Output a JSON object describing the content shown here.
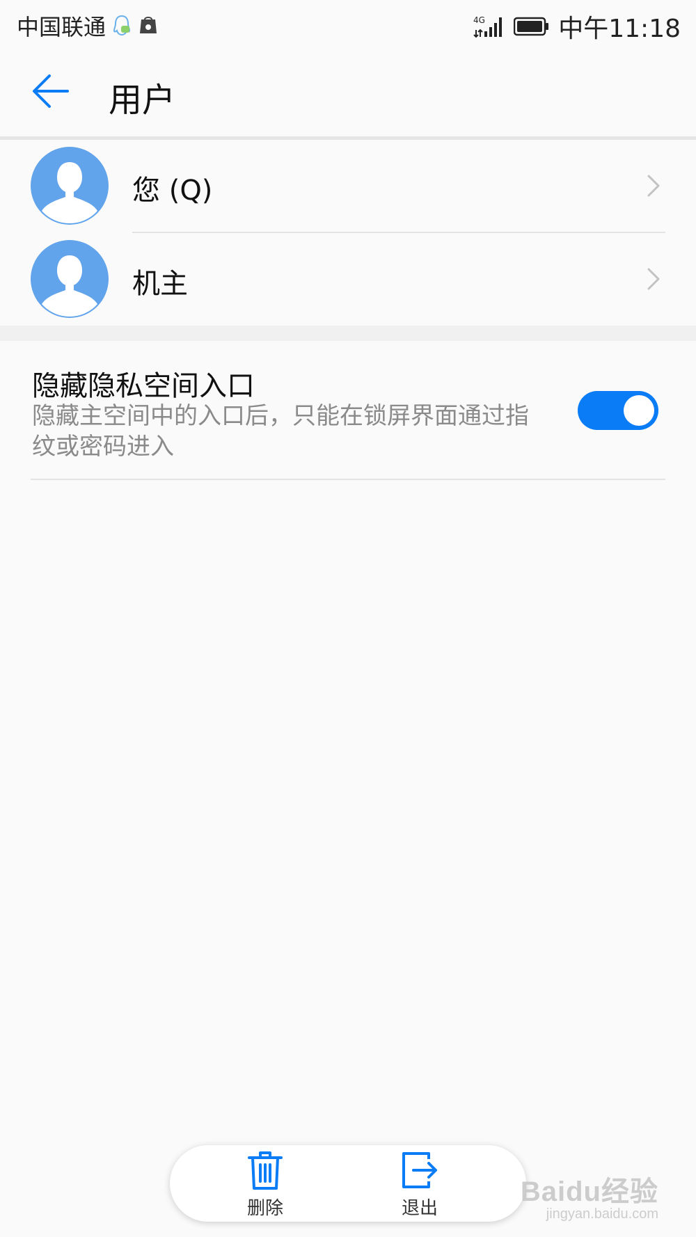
{
  "status_bar": {
    "carrier": "中国联通",
    "network": "4G",
    "time": "中午11:18"
  },
  "header": {
    "title": "用户"
  },
  "users": [
    {
      "label": "您 (Q)"
    },
    {
      "label": "机主"
    }
  ],
  "setting": {
    "title": "隐藏隐私空间入口",
    "description": "隐藏主空间中的入口后，只能在锁屏界面通过指纹或密码进入",
    "enabled": true
  },
  "actions": {
    "delete_label": "删除",
    "exit_label": "退出"
  },
  "watermark": {
    "main": "Baidu经验",
    "sub": "jingyan.baidu.com"
  },
  "colors": {
    "accent": "#0a7cf5",
    "avatar": "#62a4eb",
    "background": "#fafafa"
  }
}
